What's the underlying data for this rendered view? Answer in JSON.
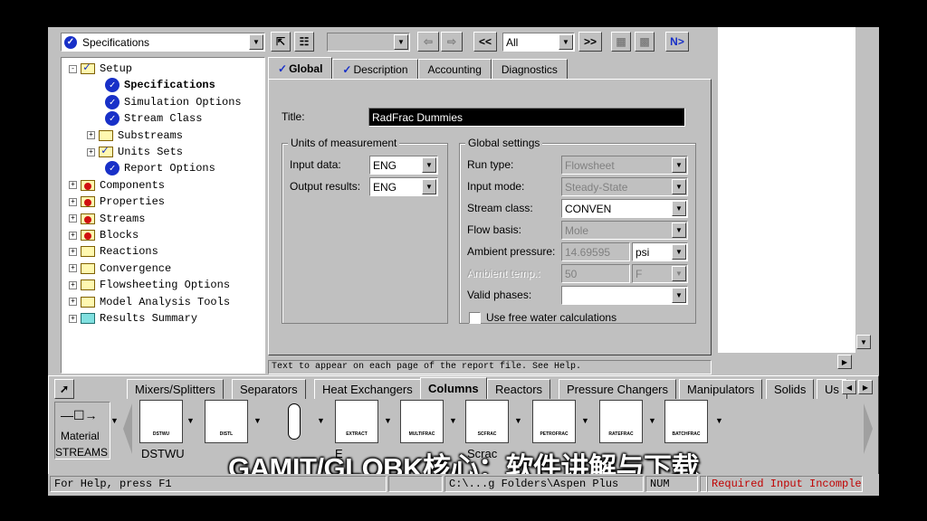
{
  "toolbar": {
    "form_select": "Specifications",
    "nav_select": "All",
    "prev_label": "<<",
    "next_label": ">>",
    "next_input_label": "N>"
  },
  "tree": [
    {
      "label": "Setup",
      "expander": "-",
      "icon": "folder-check"
    },
    {
      "label": "Specifications",
      "icon": "blue-check",
      "bold": true
    },
    {
      "label": "Simulation Options",
      "icon": "blue-check"
    },
    {
      "label": "Stream Class",
      "icon": "blue-check"
    },
    {
      "label": "Substreams",
      "expander": "+",
      "icon": "folder"
    },
    {
      "label": "Units Sets",
      "expander": "+",
      "icon": "folder-check"
    },
    {
      "label": "Report Options",
      "icon": "blue-check"
    },
    {
      "label": "Components",
      "expander": "+",
      "icon": "folder-red"
    },
    {
      "label": "Properties",
      "expander": "+",
      "icon": "folder-red"
    },
    {
      "label": "Streams",
      "expander": "+",
      "icon": "folder-red"
    },
    {
      "label": "Blocks",
      "expander": "+",
      "icon": "folder-red"
    },
    {
      "label": "Reactions",
      "expander": "+",
      "icon": "folder"
    },
    {
      "label": "Convergence",
      "expander": "+",
      "icon": "folder"
    },
    {
      "label": "Flowsheeting Options",
      "expander": "+",
      "icon": "folder"
    },
    {
      "label": "Model Analysis Tools",
      "expander": "+",
      "icon": "folder"
    },
    {
      "label": "Results Summary",
      "expander": "+",
      "icon": "folder-teal"
    }
  ],
  "form": {
    "tabs": [
      "Global",
      "Description",
      "Accounting",
      "Diagnostics"
    ],
    "title_label": "Title:",
    "title_value": "RadFrac Dummies",
    "units_group": "Units of measurement",
    "input_data_label": "Input data:",
    "input_data_value": "ENG",
    "output_results_label": "Output results:",
    "output_results_value": "ENG",
    "global_group": "Global settings",
    "run_type_label": "Run type:",
    "run_type_value": "Flowsheet",
    "input_mode_label": "Input mode:",
    "input_mode_value": "Steady-State",
    "stream_class_label": "Stream class:",
    "stream_class_value": "CONVEN",
    "flow_basis_label": "Flow basis:",
    "flow_basis_value": "Mole",
    "ambient_pressure_label": "Ambient pressure:",
    "ambient_pressure_value": "14.69595",
    "ambient_pressure_unit": "psi",
    "ambient_temp_label": "Ambient temp.:",
    "ambient_temp_value": "50",
    "ambient_temp_unit": "F",
    "valid_phases_label": "Valid phases:",
    "valid_phases_value": "",
    "free_water_label": "Use free water calculations"
  },
  "help_line": "Text to appear on each page of the report file. See Help.",
  "palette": {
    "tabs": [
      "Mixers/Splitters",
      "Separators",
      "Heat Exchangers",
      "Columns",
      "Reactors",
      "Pressure Changers",
      "Manipulators",
      "Solids",
      "Us"
    ],
    "active_tab": "Columns",
    "stream_type": "Material",
    "streams_label": "STREAMS",
    "models": [
      "DSTWU",
      "DISTL",
      "",
      "EXTRACT",
      "MULTIFRAC",
      "SCFRAC",
      "PETROFRAC",
      "RATEFRAC",
      "BATCHFRAC"
    ],
    "caption_first": "DSTWU",
    "caption_partial_e": "E",
    "caption_partial_scfrac": "Scrac"
  },
  "subtitle": "GAMIT/GLOBK核心：软件讲解与下载",
  "status": {
    "help": "For Help, press F1",
    "path": "C:\\...g Folders\\Aspen Plus",
    "num": "NUM",
    "message": "Required Input Incomple"
  },
  "colors": {
    "title_field_bg": "#000000",
    "title_field_fg": "#ffffff",
    "status_warning": "#c00000",
    "check_blue": "#1830c8"
  }
}
